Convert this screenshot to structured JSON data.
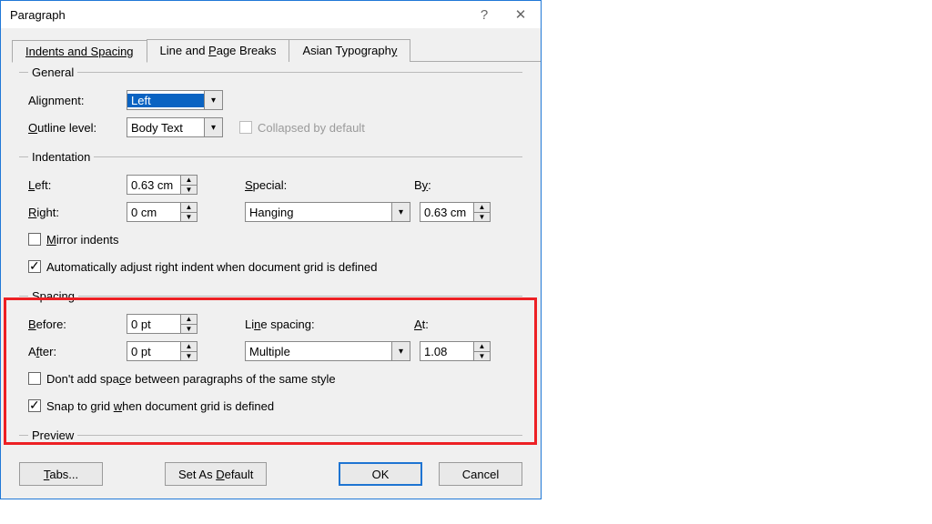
{
  "title": "Paragraph",
  "tabs": {
    "indents": "Indents and Spacing",
    "breaks_pre": "Line and ",
    "breaks_u": "P",
    "breaks_post": "age Breaks",
    "asian_pre": "Asian Typograph",
    "asian_u": "y"
  },
  "general": {
    "legend": "General",
    "alignment_pre": "Ali",
    "alignment_u": "g",
    "alignment_post": "nment:",
    "alignment_value": "Left",
    "outline_u": "O",
    "outline_post": "utline level:",
    "outline_value": "Body Text",
    "collapsed": "Collapsed by default"
  },
  "indent": {
    "legend": "Indentation",
    "left_u": "L",
    "left_post": "eft:",
    "left_value": "0.63 cm",
    "right_u": "R",
    "right_post": "ight:",
    "right_value": "0 cm",
    "special_u": "S",
    "special_post": "pecial:",
    "special_value": "Hanging",
    "by_pre": "B",
    "by_u": "y",
    "by_post": ":",
    "by_value": "0.63 cm",
    "mirror_u": "M",
    "mirror_post": "irror indents",
    "autoadj_pre": "Automatically ad",
    "autoadj_u": "j",
    "autoadj_post": "ust right indent when document grid is defined"
  },
  "spacing": {
    "legend": "Spacing",
    "before_u": "B",
    "before_post": "efore:",
    "before_value": "0 pt",
    "after_pre": "A",
    "after_u": "f",
    "after_post": "ter:",
    "after_value": "0 pt",
    "linesp_pre": "Li",
    "linesp_u": "n",
    "linesp_post": "e spacing:",
    "linesp_value": "Multiple",
    "at_u": "A",
    "at_post": "t:",
    "at_value": "1.08",
    "dontadd_pre": "Don't add spa",
    "dontadd_u": "c",
    "dontadd_post": "e between paragraphs of the same style",
    "snap_pre": "Snap to grid ",
    "snap_u": "w",
    "snap_post": "hen document grid is defined"
  },
  "preview": "Preview",
  "buttons": {
    "tabs_u": "T",
    "tabs_post": "abs...",
    "default_pre": "Set As ",
    "default_u": "D",
    "default_post": "efault",
    "ok": "OK",
    "cancel": "Cancel"
  }
}
